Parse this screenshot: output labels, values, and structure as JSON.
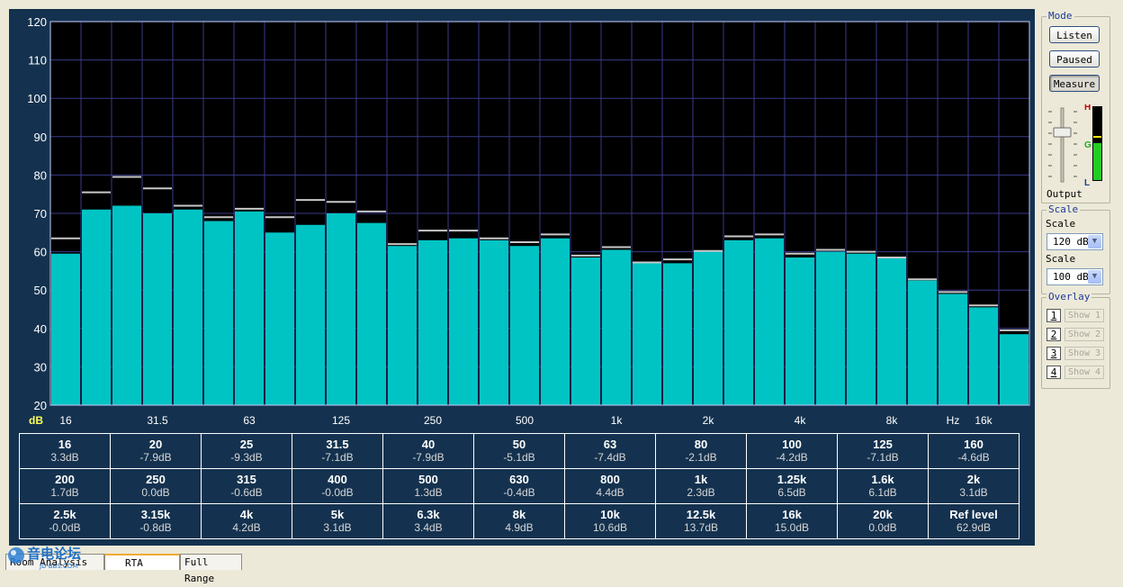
{
  "chart_data": {
    "type": "bar",
    "ylim": [
      20,
      120
    ],
    "yticks": [
      20,
      30,
      40,
      50,
      60,
      70,
      80,
      90,
      100,
      110,
      120
    ],
    "y_unit_label": "dB",
    "x_tick_labels": [
      "16",
      "31.5",
      "63",
      "125",
      "250",
      "500",
      "1k",
      "2k",
      "4k",
      "8k",
      "Hz",
      "16k"
    ],
    "x_tick_bands": [
      0,
      3,
      6,
      9,
      12,
      15,
      18,
      21,
      24,
      27,
      29,
      30
    ],
    "grid": true,
    "series": [
      {
        "values": [
          59.5,
          71,
          72,
          70,
          71,
          68,
          70.5,
          65,
          67,
          70,
          67.5,
          61.5,
          63,
          63.5,
          63,
          61.5,
          63.5,
          58.5,
          60.5,
          57,
          57,
          60,
          63,
          63.5,
          58.5,
          60,
          59.5,
          58.5,
          52.5,
          49,
          45.5,
          38.5
        ]
      },
      {
        "values": [
          63.5,
          75.5,
          79.5,
          76.5,
          72,
          69,
          71.2,
          69,
          73.5,
          73,
          70.5,
          62,
          65.5,
          65.5,
          63.5,
          62.5,
          64.5,
          59,
          61.2,
          57.2,
          58,
          60.2,
          64,
          64.5,
          59.5,
          60.5,
          60,
          58.5,
          52.8,
          49.5,
          46,
          39.5
        ]
      }
    ]
  },
  "band_table": [
    [
      {
        "freq": "16",
        "gain": "3.3dB"
      },
      {
        "freq": "20",
        "gain": "-7.9dB"
      },
      {
        "freq": "25",
        "gain": "-9.3dB"
      },
      {
        "freq": "31.5",
        "gain": "-7.1dB"
      },
      {
        "freq": "40",
        "gain": "-7.9dB"
      },
      {
        "freq": "50",
        "gain": "-5.1dB"
      },
      {
        "freq": "63",
        "gain": "-7.4dB"
      },
      {
        "freq": "80",
        "gain": "-2.1dB"
      },
      {
        "freq": "100",
        "gain": "-4.2dB"
      },
      {
        "freq": "125",
        "gain": "-7.1dB"
      },
      {
        "freq": "160",
        "gain": "-4.6dB"
      }
    ],
    [
      {
        "freq": "200",
        "gain": "1.7dB"
      },
      {
        "freq": "250",
        "gain": "0.0dB"
      },
      {
        "freq": "315",
        "gain": "-0.6dB"
      },
      {
        "freq": "400",
        "gain": "-0.0dB"
      },
      {
        "freq": "500",
        "gain": "1.3dB"
      },
      {
        "freq": "630",
        "gain": "-0.4dB"
      },
      {
        "freq": "800",
        "gain": "4.4dB"
      },
      {
        "freq": "1k",
        "gain": "2.3dB"
      },
      {
        "freq": "1.25k",
        "gain": "6.5dB"
      },
      {
        "freq": "1.6k",
        "gain": "6.1dB"
      },
      {
        "freq": "2k",
        "gain": "3.1dB"
      }
    ],
    [
      {
        "freq": "2.5k",
        "gain": "-0.0dB"
      },
      {
        "freq": "3.15k",
        "gain": "-0.8dB"
      },
      {
        "freq": "4k",
        "gain": "4.2dB"
      },
      {
        "freq": "5k",
        "gain": "3.1dB"
      },
      {
        "freq": "6.3k",
        "gain": "3.4dB"
      },
      {
        "freq": "8k",
        "gain": "4.9dB"
      },
      {
        "freq": "10k",
        "gain": "10.6dB"
      },
      {
        "freq": "12.5k",
        "gain": "13.7dB"
      },
      {
        "freq": "16k",
        "gain": "15.0dB"
      },
      {
        "freq": "20k",
        "gain": "0.0dB"
      },
      {
        "freq": "Ref level",
        "gain": "62.9dB"
      }
    ]
  ],
  "side_panel": {
    "mode_title": "Mode",
    "buttons": {
      "listen": "Listen",
      "paused": "Paused",
      "measure": "Measure"
    },
    "output_label": "Output",
    "meter_labels": {
      "high": "H",
      "good": "G",
      "low": "L"
    },
    "output_level": 0.55,
    "scale_title": "Scale",
    "scale_label_1": "Scale",
    "scale_value_1": "120 dB",
    "scale_label_2": "Scale",
    "scale_value_2": "100 dB",
    "overlay_title": "Overlay",
    "overlays": [
      {
        "num": "1",
        "label": "Show 1"
      },
      {
        "num": "2",
        "label": "Show 2"
      },
      {
        "num": "3",
        "label": "Show 3"
      },
      {
        "num": "4",
        "label": "Show 4"
      }
    ]
  },
  "tabs": {
    "room_analysis": "Room Analysis",
    "rta": "RTA",
    "full_range": "Full Range"
  },
  "logo": {
    "text": "音电论坛",
    "sub": "JD-BBS.COM"
  },
  "colors": {
    "panel": "#14324f",
    "plot_bg": "#000000",
    "grid": "#3a3a8a",
    "bar": "#00c4c4",
    "peak": "#c8c8c8",
    "meter": "#22cc22"
  }
}
